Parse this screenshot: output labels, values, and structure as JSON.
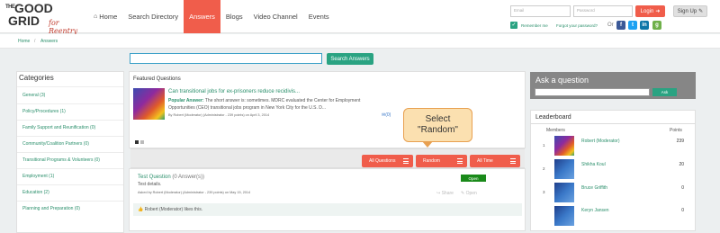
{
  "logo": {
    "line1": "THE",
    "word": "GOOD",
    "line2": "GRID",
    "tag": "for Reentry"
  },
  "nav": {
    "home": "Home",
    "search_dir": "Search Directory",
    "answers": "Answers",
    "blogs": "Blogs",
    "video": "Video Channel",
    "events": "Events"
  },
  "login": {
    "email_ph": "Email",
    "password_ph": "Password",
    "login_label": "Login",
    "signup_label": "Sign Up",
    "remember": "Remember me",
    "forgot": "Forgot your password?",
    "or": "Or"
  },
  "breadcrumb": {
    "home": "Home",
    "sep": "/",
    "current": "Answers"
  },
  "search": {
    "button": "Search Answers"
  },
  "categories": {
    "title": "Categories",
    "items": [
      "General (3)",
      "Policy/Procedures (1)",
      "Family Support and Reunification (0)",
      "Community/Coalition Partners (0)",
      "Transitional Programs & Volunteers (0)",
      "Employment (1)",
      "Education (2)",
      "Planning and Preparation (0)"
    ]
  },
  "featured": {
    "title": "Featured Questions",
    "question": "Can transitional jobs for ex-prisoners reduce recidivis...",
    "answer_label": "Popular Answer:",
    "answer_text": "The short answer is: sometimes. MDRC evaluated the Center for Employment Opportunities (CEO) transitional jobs program in New York City for the U.S. D...",
    "meta": "By Robert (Moderator) (Administrator - 239 points) on April 3, 2014",
    "count": "(0)"
  },
  "tabs": {
    "all_q": "All Questions",
    "random": "Random",
    "all_time": "All Time"
  },
  "callout": {
    "line1": "Select",
    "line2": "\"Random\""
  },
  "test_question": {
    "title": "Test Question",
    "answers": "(0 Answer(s))",
    "details": "Test details.",
    "status": "Open",
    "meta": "Asked by Robert (Moderator) (Administrator - 239 points) on May 15, 2014",
    "share": "Share",
    "open": "Open",
    "likes": "Robert (Moderator) likes this."
  },
  "ask": {
    "title": "Ask a question",
    "button": "Ask"
  },
  "leaderboard": {
    "title": "Leaderboard",
    "col_members": "Members",
    "col_points": "Points",
    "rows": [
      {
        "rank": "1",
        "name": "Robert (Moderator)",
        "points": "239"
      },
      {
        "rank": "2",
        "name": "Shikha Koul",
        "points": "20"
      },
      {
        "rank": "3",
        "name": "Bruce Griffith",
        "points": "0"
      },
      {
        "rank": "",
        "name": "Keryn Jansen",
        "points": "0"
      }
    ]
  }
}
